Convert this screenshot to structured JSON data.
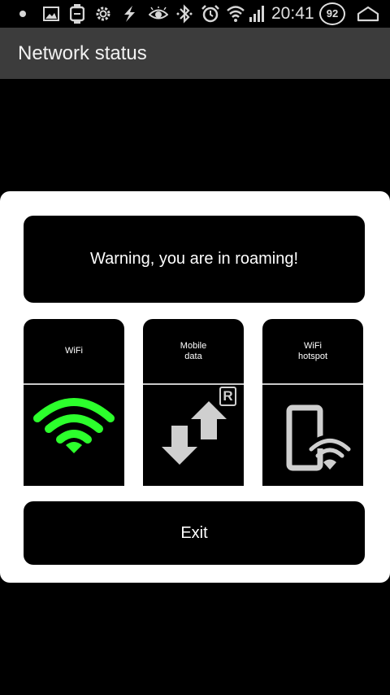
{
  "status_bar": {
    "time": "20:41",
    "battery": "92",
    "icons": [
      "notification-dot-icon",
      "gallery-icon",
      "watch-icon",
      "gear-icon",
      "flash-icon",
      "eye-icon",
      "bluetooth-icon",
      "alarm-icon",
      "wifi-signal-icon",
      "cell-signal-icon",
      "home-icon"
    ]
  },
  "app_bar": {
    "title": "Network status"
  },
  "dialog": {
    "warning": "Warning, you are in roaming!",
    "tiles": [
      {
        "id": "wifi",
        "label_line1": "WiFi",
        "label_line2": "",
        "icon": "wifi-icon",
        "state_color": "#2cff2c"
      },
      {
        "id": "mobile-data",
        "label_line1": "Mobile",
        "label_line2": "data",
        "icon": "mobile-data-roaming-icon",
        "badge": "R",
        "state_color": "#cfcfcf"
      },
      {
        "id": "wifi-hotspot",
        "label_line1": "WiFi",
        "label_line2": "hotspot",
        "icon": "phone-hotspot-icon",
        "state_color": "#cfcfcf"
      }
    ],
    "exit_label": "Exit"
  },
  "colors": {
    "background": "#000000",
    "app_bar": "#3c3c3c",
    "dialog": "#ffffff",
    "wifi_active": "#2cff2c",
    "icon_inactive": "#cfcfcf"
  }
}
